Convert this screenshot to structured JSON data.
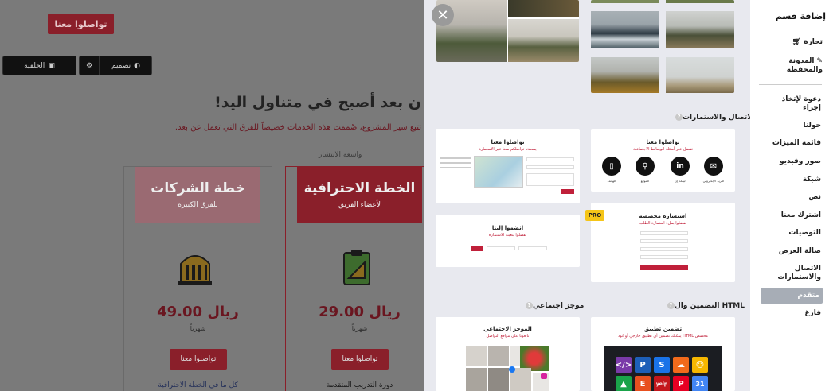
{
  "background": {
    "contact_button": "تواصلوا معنا",
    "toolbar": {
      "background_label": "الخلفية",
      "design_label": "تصميم"
    },
    "headline": "ن بعد أصبح في متناول اليد!",
    "subheadline": "تتبع سير المشروع، صُممت هذه الخدمات خصيصاً للفرق التي تعمل عن بعد.",
    "popular_label": "واسعة الانتشار",
    "plans": [
      {
        "title": "خطة الشركات",
        "subtitle": "للفرق الكبيرة",
        "price": "49.00 ريال",
        "period": "شهرياً",
        "button": "تواصلوا معنا",
        "extra": "كل ما في الخطة الاحترافية"
      },
      {
        "title": "الخطة الاحترافية",
        "subtitle": "لأعضاء الفريق",
        "price": "29.00 ريال",
        "period": "شهرياً",
        "button": "تواصلوا معنا",
        "extra": "دورة التدريب المتقدمة"
      }
    ]
  },
  "sidebar": {
    "title": "إضافة قسم",
    "items": [
      {
        "label": "تجارة",
        "icon": "cart-icon"
      },
      {
        "label": "المدونة والمحفظة",
        "icon": "edit-icon"
      },
      {
        "label": "دعوة لإتخاذ إجراء"
      },
      {
        "label": "حولنا"
      },
      {
        "label": "قائمة الميزات"
      },
      {
        "label": "صور وفيديو"
      },
      {
        "label": "شبكة"
      },
      {
        "label": "نص"
      },
      {
        "label": "اشترك معنا"
      },
      {
        "label": "التوصيات"
      },
      {
        "label": "صالة العرض"
      },
      {
        "label": "الاتصال والاستمارات"
      },
      {
        "label": "متقدم",
        "active": true
      },
      {
        "label": "فارغ"
      }
    ]
  },
  "sections": {
    "contact_forms": "الاتصال والاستمارات",
    "embed_html": "التضمين وال HTML",
    "social_summary": "موجز اجتماعي"
  },
  "cards": {
    "contact_icons": {
      "title": "تواصلوا معنا",
      "sub": "تفضل عبر أسئلة الوسائط الاجتماعية",
      "labels": [
        "البريد الإلكتروني",
        "لينكد إن",
        "الموقع",
        "الهاتف"
      ]
    },
    "contact_map": {
      "title": "تواصلوا معنا",
      "sub": "يسعدنا تواصلكم معنا عبر الاستمارة"
    },
    "custom_consult": {
      "title": "استشارة مخصصة",
      "sub": "تفضلوا بملء استمارة الطلب"
    },
    "join_us": {
      "title": "انضموا إلينا",
      "sub": "تفضلوا بتعبئة الاستمارة"
    },
    "embed_app": {
      "title": "تضمين تطبيق",
      "sub": "يمكنك تضمين أي تطبيق خارجي أو كود HTML مخصص"
    },
    "social_feed": {
      "title": "الموجز الاجتماعي",
      "sub": "تابعونا على مواقع التواصل"
    },
    "pro_badge": "PRO"
  },
  "colors": {
    "accent": "#c0203a",
    "active_sidebar": "#a7adb6",
    "panel_bg": "#e8e9ef"
  }
}
